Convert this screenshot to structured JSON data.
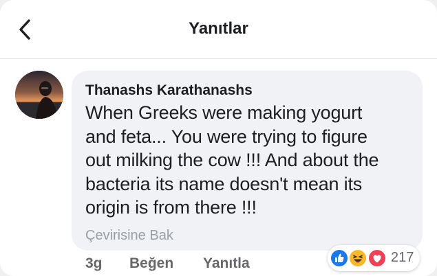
{
  "header": {
    "title": "Yanıtlar",
    "back_icon": "chevron-left-icon"
  },
  "comment": {
    "author": "Thanashs Karathanashs",
    "text_lines": [
      "When Greeks were making yogurt",
      "and feta... You were trying to figure",
      "out milking the cow !!! And about the",
      "bacteria its name doesn't mean its",
      "origin is from there !!!"
    ],
    "translate_label": "Çevirisine Bak"
  },
  "actions": {
    "time": "3g",
    "like_label": "Beğen",
    "reply_label": "Yanıtla"
  },
  "reactions": {
    "types": [
      "like-icon",
      "haha-icon",
      "love-icon"
    ],
    "count": "217",
    "colors": {
      "like": "#1877f2",
      "haha": "#f7b928",
      "love": "#f33e58"
    }
  }
}
